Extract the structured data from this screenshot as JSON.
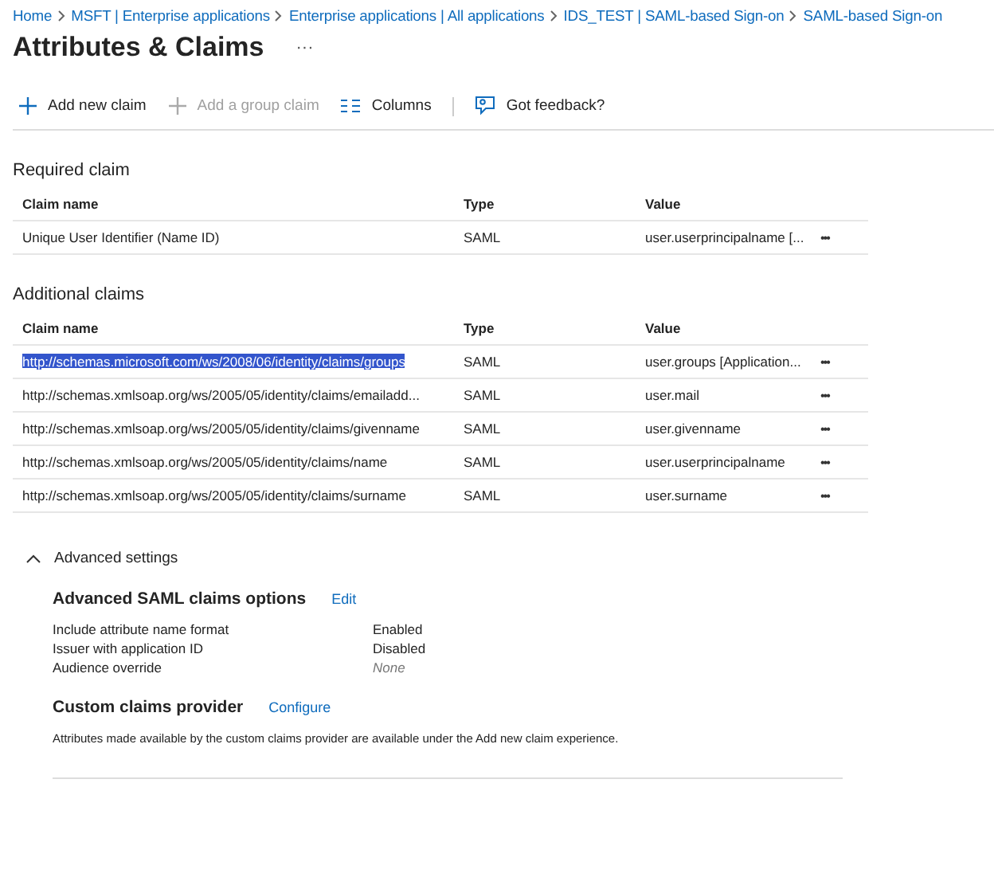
{
  "breadcrumb": [
    "Home",
    "MSFT | Enterprise applications",
    "Enterprise applications | All applications",
    "IDS_TEST | SAML-based Sign-on",
    "SAML-based Sign-on"
  ],
  "title": "Attributes & Claims",
  "more": "···",
  "toolbar": [
    {
      "kind": "add",
      "label": "Add new claim",
      "disabled": false
    },
    {
      "kind": "add",
      "label": "Add a group claim",
      "disabled": true
    },
    {
      "kind": "columns",
      "label": "Columns",
      "disabled": false
    },
    {
      "kind": "feedback",
      "label": "Got feedback?",
      "disabled": false
    }
  ],
  "required": {
    "title": "Required claim",
    "columns": [
      "Claim name",
      "Type",
      "Value"
    ],
    "rows": [
      {
        "name": "Unique User Identifier (Name ID)",
        "type": "SAML",
        "value": "user.userprincipalname [...",
        "more": "•••",
        "selected": false
      }
    ]
  },
  "additional": {
    "title": "Additional claims",
    "columns": [
      "Claim name",
      "Type",
      "Value"
    ],
    "rows": [
      {
        "name": "http://schemas.microsoft.com/ws/2008/06/identity/claims/groups",
        "type": "SAML",
        "value": "user.groups [Application...",
        "more": "•••",
        "selected": true
      },
      {
        "name": "http://schemas.xmlsoap.org/ws/2005/05/identity/claims/emailadd...",
        "type": "SAML",
        "value": "user.mail",
        "more": "•••",
        "selected": false
      },
      {
        "name": "http://schemas.xmlsoap.org/ws/2005/05/identity/claims/givenname",
        "type": "SAML",
        "value": "user.givenname",
        "more": "•••",
        "selected": false
      },
      {
        "name": "http://schemas.xmlsoap.org/ws/2005/05/identity/claims/name",
        "type": "SAML",
        "value": "user.userprincipalname",
        "more": "•••",
        "selected": false
      },
      {
        "name": "http://schemas.xmlsoap.org/ws/2005/05/identity/claims/surname",
        "type": "SAML",
        "value": "user.surname",
        "more": "•••",
        "selected": false
      }
    ]
  },
  "advanced": {
    "label": "Advanced settings",
    "expanded": true,
    "options": {
      "title": "Advanced SAML claims options",
      "link": "Edit",
      "settings": [
        {
          "label": "Include attribute name format",
          "value": "Enabled",
          "kind": "set"
        },
        {
          "label": "Issuer with application ID",
          "value": "Disabled",
          "kind": "set"
        },
        {
          "label": "Audience override",
          "value": "None",
          "kind": "unset"
        }
      ]
    },
    "provider": {
      "title": "Custom claims provider",
      "link": "Configure",
      "description": "Attributes made available by the custom claims provider are available under the Add new claim experience."
    }
  }
}
